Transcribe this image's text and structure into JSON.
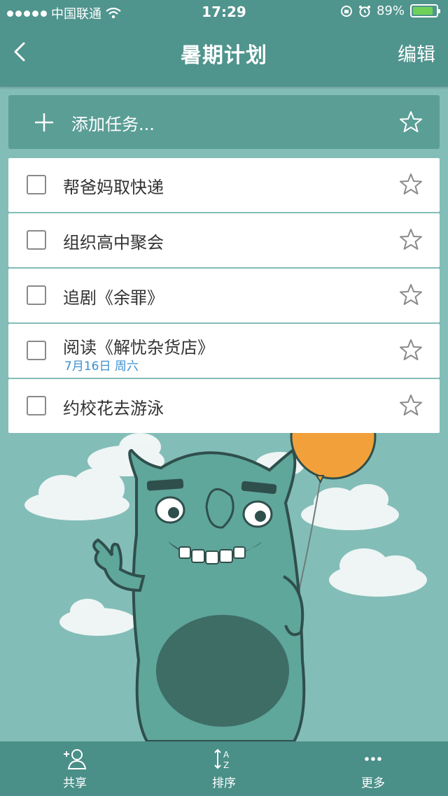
{
  "status_bar": {
    "carrier": "中国联通",
    "time": "17:29",
    "battery": "89%",
    "battery_level": 0.89
  },
  "nav": {
    "title": "暑期计划",
    "edit_label": "编辑"
  },
  "add_task": {
    "placeholder": "添加任务..."
  },
  "tasks": [
    {
      "label": "帮爸妈取快递",
      "date": ""
    },
    {
      "label": "组织高中聚会",
      "date": ""
    },
    {
      "label": "追剧《余罪》",
      "date": ""
    },
    {
      "label": "阅读《解忧杂货店》",
      "date": "7月16日 周六"
    },
    {
      "label": "约校花去游泳",
      "date": ""
    }
  ],
  "tabbar": {
    "share": "共享",
    "sort": "排序",
    "more": "更多"
  },
  "colors": {
    "header": "#4f948d",
    "background": "#83bdb7",
    "date_text": "#3b8fd1",
    "balloon": "#f2a13a"
  }
}
